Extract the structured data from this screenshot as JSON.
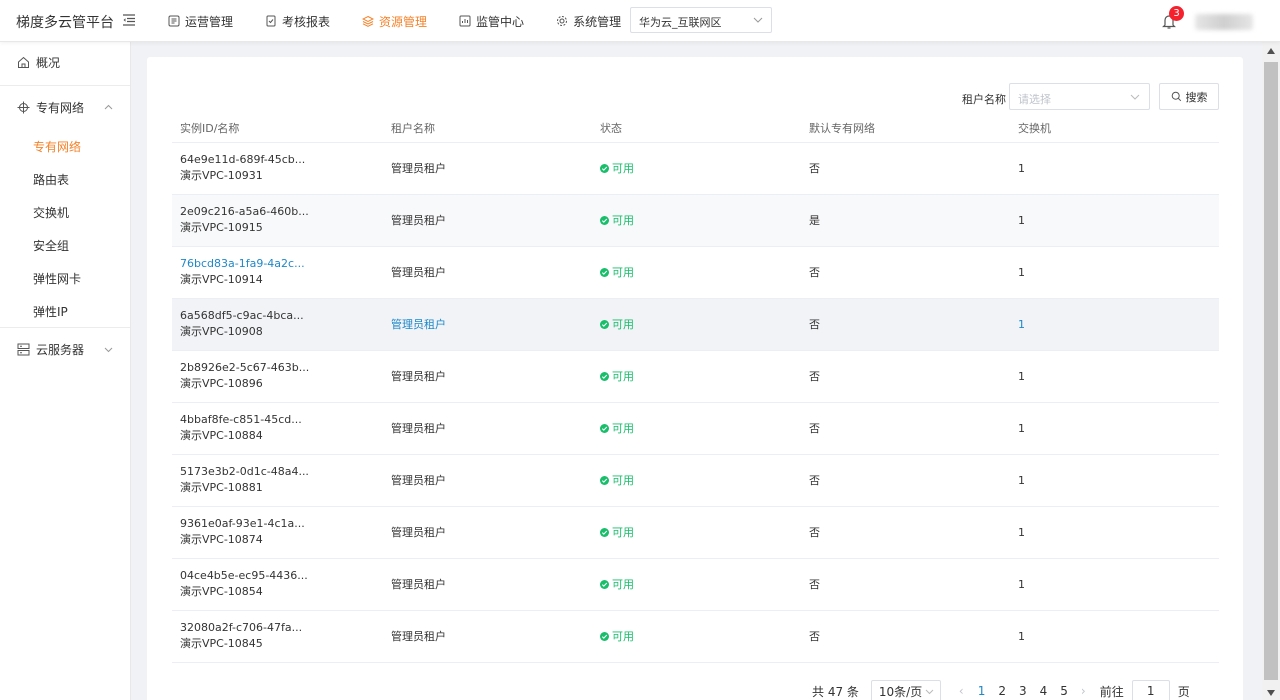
{
  "header": {
    "brand": "梯度多云管平台",
    "nav": [
      {
        "label": "运营管理",
        "icon": "operations-icon",
        "active": false
      },
      {
        "label": "考核报表",
        "icon": "report-icon",
        "active": false
      },
      {
        "label": "资源管理",
        "icon": "layers-icon",
        "active": true
      },
      {
        "label": "监管中心",
        "icon": "monitor-icon",
        "active": false
      },
      {
        "label": "系统管理",
        "icon": "gear-icon",
        "active": false
      }
    ],
    "region": "华为云_互联网区",
    "notification_count": "3"
  },
  "sidebar": {
    "overview": "概况",
    "vpc_group": "专有网络",
    "vpc_items": [
      "专有网络",
      "路由表",
      "交换机",
      "安全组",
      "弹性网卡",
      "弹性IP"
    ],
    "active_item": "专有网络",
    "server_group": "云服务器"
  },
  "filter": {
    "label": "租户名称",
    "placeholder": "请选择",
    "search_label": "搜索"
  },
  "table": {
    "columns": [
      "实例ID/名称",
      "租户名称",
      "状态",
      "默认专有网络",
      "交换机"
    ],
    "rows": [
      {
        "id": "64e9e11d-689f-45cb...",
        "name": "演示VPC-10931",
        "tenant": "管理员租户",
        "status": "可用",
        "default_vpc": "否",
        "switches": "1"
      },
      {
        "id": "2e09c216-a5a6-460b...",
        "name": "演示VPC-10915",
        "tenant": "管理员租户",
        "status": "可用",
        "default_vpc": "是",
        "switches": "1"
      },
      {
        "id": "76bcd83a-1fa9-4a2c...",
        "name": "演示VPC-10914",
        "tenant": "管理员租户",
        "status": "可用",
        "default_vpc": "否",
        "switches": "1"
      },
      {
        "id": "6a568df5-c9ac-4bca...",
        "name": "演示VPC-10908",
        "tenant": "管理员租户",
        "status": "可用",
        "default_vpc": "否",
        "switches": "1"
      },
      {
        "id": "2b8926e2-5c67-463b...",
        "name": "演示VPC-10896",
        "tenant": "管理员租户",
        "status": "可用",
        "default_vpc": "否",
        "switches": "1"
      },
      {
        "id": "4bbaf8fe-c851-45cd...",
        "name": "演示VPC-10884",
        "tenant": "管理员租户",
        "status": "可用",
        "default_vpc": "否",
        "switches": "1"
      },
      {
        "id": "5173e3b2-0d1c-48a4...",
        "name": "演示VPC-10881",
        "tenant": "管理员租户",
        "status": "可用",
        "default_vpc": "否",
        "switches": "1"
      },
      {
        "id": "9361e0af-93e1-4c1a...",
        "name": "演示VPC-10874",
        "tenant": "管理员租户",
        "status": "可用",
        "default_vpc": "否",
        "switches": "1"
      },
      {
        "id": "04ce4b5e-ec95-4436...",
        "name": "演示VPC-10854",
        "tenant": "管理员租户",
        "status": "可用",
        "default_vpc": "否",
        "switches": "1"
      },
      {
        "id": "32080a2f-c706-47fa...",
        "name": "演示VPC-10845",
        "tenant": "管理员租户",
        "status": "可用",
        "default_vpc": "否",
        "switches": "1"
      }
    ]
  },
  "pagination": {
    "total": "共 47 条",
    "page_size": "10条/页",
    "pages": [
      "1",
      "2",
      "3",
      "4",
      "5"
    ],
    "current": "1",
    "goto_label": "前往",
    "goto_value": "1",
    "page_unit": "页"
  },
  "colors": {
    "accent": "#f5822a",
    "link": "#1e88c9",
    "success": "#19be6b",
    "badge": "#f5222d"
  }
}
